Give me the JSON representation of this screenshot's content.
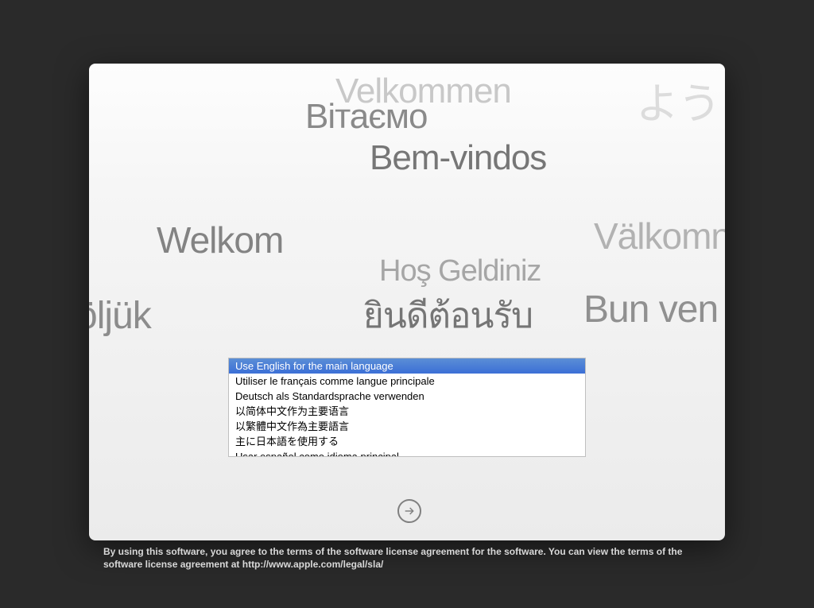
{
  "welcome_words": {
    "w1": "Velkommen",
    "w2": "Вітаємо",
    "w3": "ようこ",
    "w4": "Bem-vindos",
    "w5": "Welkom",
    "w6": "Välkomn",
    "w7": "Hoş Geldiniz",
    "w8": "öljük",
    "w9": "ยินดีต้อนรับ",
    "w10": "Bun ven"
  },
  "languages": [
    "Use English for the main language",
    "Utiliser le français comme langue principale",
    "Deutsch als Standardsprache verwenden",
    "以简体中文作为主要语言",
    "以繁體中文作為主要語言",
    "主に日本語を使用する",
    "Usar español como idioma principal"
  ],
  "legal": "By using this software, you agree to the terms of the software license agreement for the software. You can view the terms of the software license agreement at http://www.apple.com/legal/sla/"
}
